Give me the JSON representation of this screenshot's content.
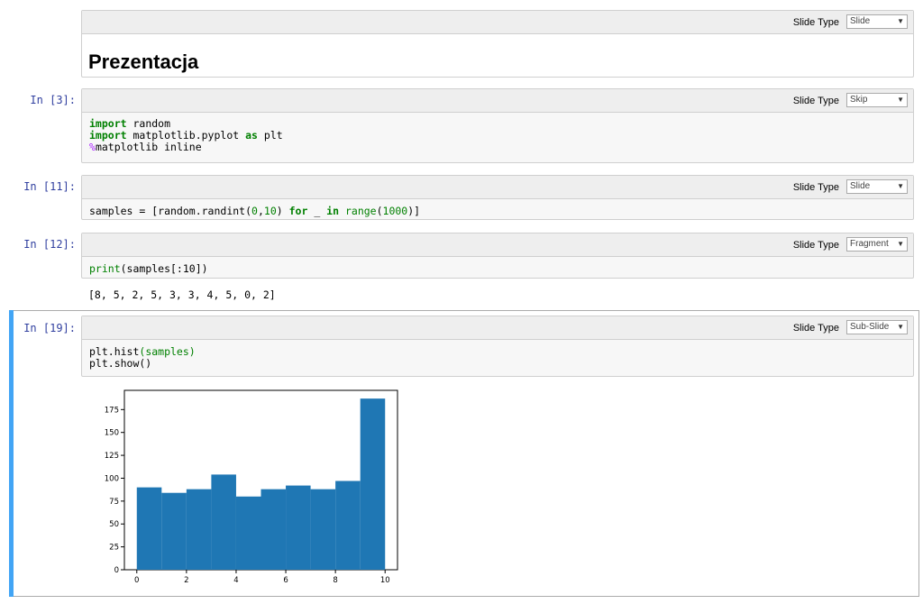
{
  "cells": [
    {
      "prompt": "",
      "slide_type_label": "Slide Type",
      "slide_type": "Slide",
      "heading": "Prezentacja"
    },
    {
      "prompt": "In [3]:",
      "slide_type_label": "Slide Type",
      "slide_type": "Skip",
      "code": {
        "l1_kw": "import",
        "l1_rest": " random",
        "l2_kw": "import",
        "l2_mid": " matplotlib.pyplot ",
        "l2_kw2": "as",
        "l2_rest": " plt",
        "l3_mg": "%",
        "l3_rest": "matplotlib inline"
      }
    },
    {
      "prompt": "In [11]:",
      "slide_type_label": "Slide Type",
      "slide_type": "Slide",
      "code": {
        "a": "samples = [random.randint(",
        "n1": "0",
        "b": ",",
        "n2": "10",
        "c": ") ",
        "kw1": "for",
        "d": " _ ",
        "kw2": "in",
        "e": " ",
        "bi": "range",
        "f": "(",
        "n3": "1000",
        "g": ")]"
      }
    },
    {
      "prompt": "In [12]:",
      "slide_type_label": "Slide Type",
      "slide_type": "Fragment",
      "code": {
        "bi": "print",
        "rest": "(samples[:10])"
      },
      "output": "[8, 5, 2, 5, 3, 3, 4, 5, 0, 2]"
    },
    {
      "prompt": "In [19]:",
      "slide_type_label": "Slide Type",
      "slide_type": "Sub-Slide",
      "code": {
        "l1a": "plt.hist",
        "l1b": "(samples)",
        "l2": "plt.show()"
      }
    }
  ],
  "chart_data": {
    "type": "bar",
    "bin_edges": [
      0,
      1,
      2,
      3,
      4,
      5,
      6,
      7,
      8,
      9,
      10
    ],
    "values": [
      90,
      84,
      88,
      104,
      80,
      88,
      92,
      88,
      97,
      187
    ],
    "xticks": [
      "0",
      "2",
      "4",
      "6",
      "8",
      "10"
    ],
    "yticks": [
      "0",
      "25",
      "50",
      "75",
      "100",
      "125",
      "150",
      "175"
    ],
    "xlim": [
      -0.5,
      10.5
    ],
    "ylim": [
      0,
      196
    ],
    "color": "#1f77b4"
  }
}
